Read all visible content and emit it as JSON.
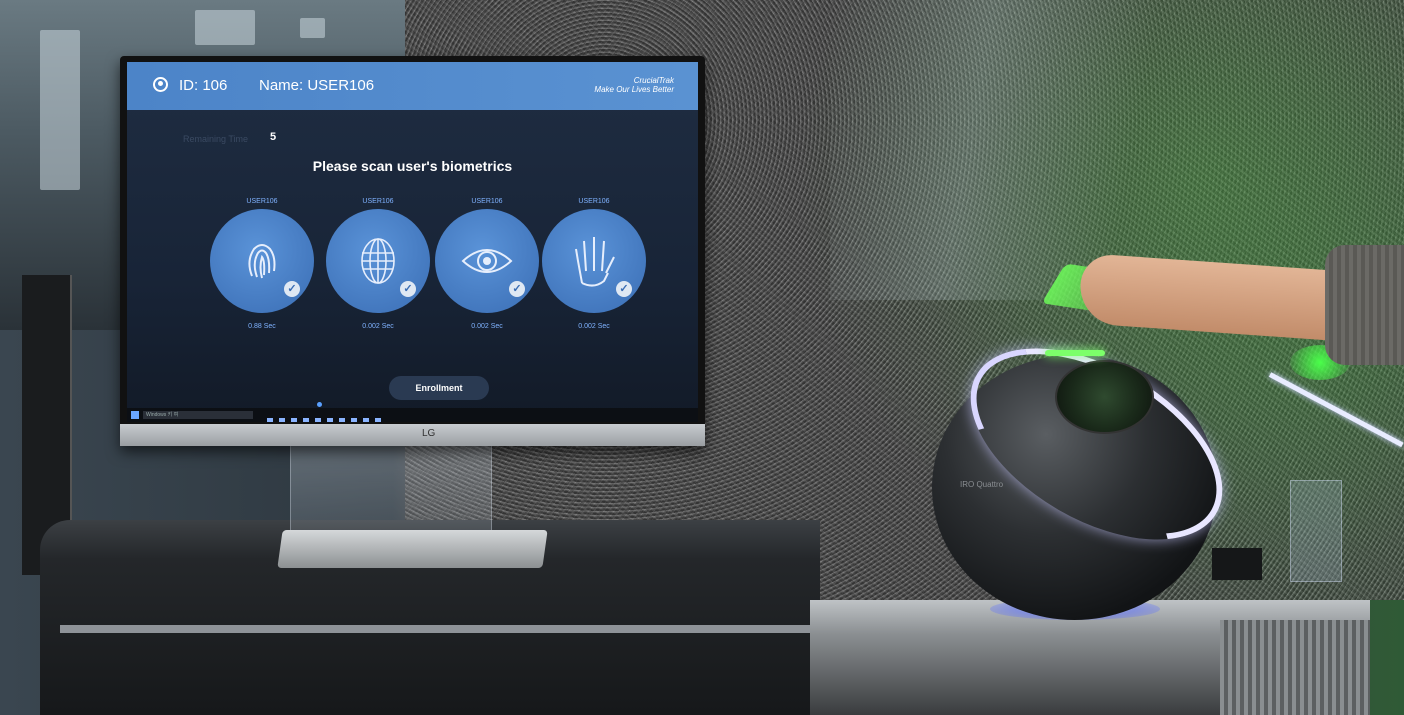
{
  "screen": {
    "id_label": "ID: 106",
    "name_label": "Name: USER106",
    "brand_line1": "CrucialTrak",
    "brand_line2": "Make Our Lives Better",
    "remaining_label": "Remaining Time",
    "remaining_value": "5",
    "prompt": "Please scan user's biometrics",
    "enrollment_button": "Enrollment",
    "biometrics": [
      {
        "user": "USER106",
        "icon": "fingerprint-icon",
        "time": "0.88 Sec"
      },
      {
        "user": "USER106",
        "icon": "face-mesh-icon",
        "time": "0.002 Sec"
      },
      {
        "user": "USER106",
        "icon": "eye-iris-icon",
        "time": "0.002 Sec"
      },
      {
        "user": "USER106",
        "icon": "hand-vein-icon",
        "time": "0.002 Sec"
      }
    ],
    "taskbar_search": "Windows 키 여",
    "monitor_brand": "LG"
  },
  "device": {
    "brand": "IRO Quattro"
  },
  "colors": {
    "topbar": "#4c84c8",
    "screen_bg": "#182437",
    "circle": "#4a80c6",
    "accent_green": "#7cff6a",
    "ring_light": "#e8e6ff"
  }
}
